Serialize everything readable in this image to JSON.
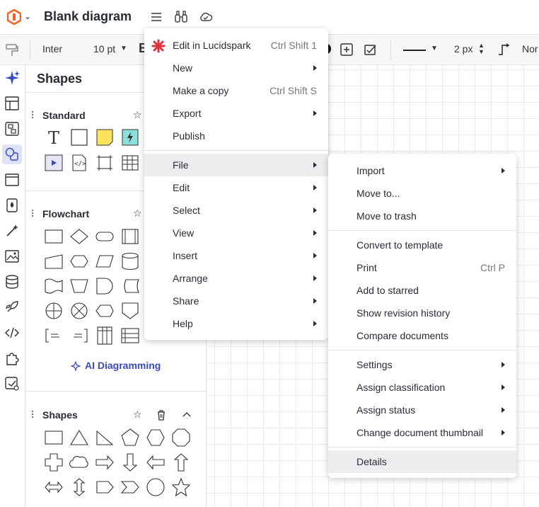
{
  "app": {
    "title": "Blank diagram"
  },
  "toolbar": {
    "font": "Inter",
    "size": "10 pt",
    "bold": "B",
    "stroke_width": "2 px",
    "trailing": "Nor"
  },
  "panel": {
    "title": "Shapes",
    "sections": {
      "standard": "Standard",
      "flowchart": "Flowchart",
      "shapes": "Shapes"
    },
    "ai_link": "AI Diagramming"
  },
  "main_menu": {
    "items": [
      {
        "label": "Edit in Lucidspark",
        "shortcut": "Ctrl Shift 1"
      },
      {
        "label": "New"
      },
      {
        "label": "Make a copy",
        "shortcut": "Ctrl Shift S"
      },
      {
        "label": "Export"
      },
      {
        "label": "Publish"
      },
      {
        "label": "File"
      },
      {
        "label": "Edit"
      },
      {
        "label": "Select"
      },
      {
        "label": "View"
      },
      {
        "label": "Insert"
      },
      {
        "label": "Arrange"
      },
      {
        "label": "Share"
      },
      {
        "label": "Help"
      }
    ]
  },
  "file_menu": {
    "items": [
      {
        "label": "Import"
      },
      {
        "label": "Move to..."
      },
      {
        "label": "Move to trash"
      },
      {
        "label": "Convert to template"
      },
      {
        "label": "Print",
        "shortcut": "Ctrl P"
      },
      {
        "label": "Add to starred"
      },
      {
        "label": "Show revision history"
      },
      {
        "label": "Compare documents"
      },
      {
        "label": "Settings"
      },
      {
        "label": "Assign classification"
      },
      {
        "label": "Assign status"
      },
      {
        "label": "Change document thumbnail"
      },
      {
        "label": "Details"
      }
    ]
  },
  "colors": {
    "accent": "#3b4bbf",
    "brand": "#f26522",
    "sparkle": "#e0323c"
  }
}
